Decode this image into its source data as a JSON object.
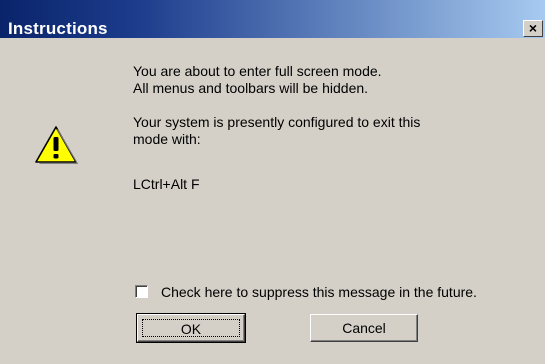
{
  "window": {
    "title": "Instructions",
    "close_glyph": "×"
  },
  "message": {
    "line1": "You are about to enter full screen mode.",
    "line2": "All menus and toolbars will be hidden.",
    "line3": "Your system is presently configured to exit this",
    "line4": "mode with:",
    "shortcut": "LCtrl+Alt F"
  },
  "icon": {
    "name": "warning-icon",
    "glyph": "!",
    "fill": "#ffff00"
  },
  "suppress": {
    "label": "Check here to suppress this message in the future.",
    "checked": false
  },
  "buttons": {
    "ok": "OK",
    "cancel": "Cancel"
  },
  "colors": {
    "titlebar_start": "#0a246a",
    "titlebar_end": "#a6caf0",
    "dialog_face": "#d4d0c8"
  }
}
